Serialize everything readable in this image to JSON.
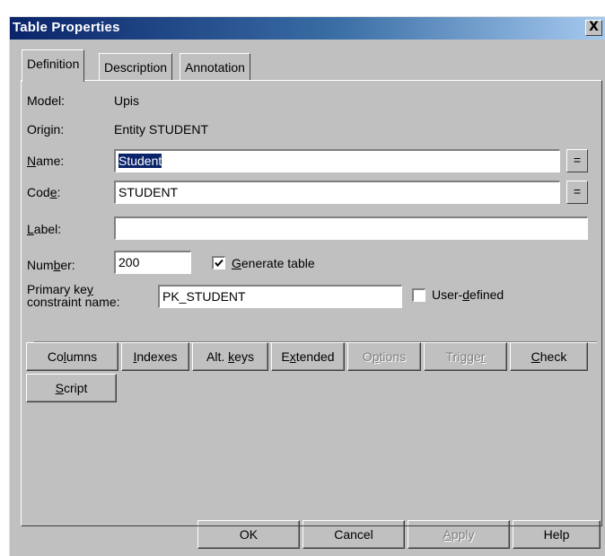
{
  "window": {
    "title": "Table Properties",
    "close_label": "X"
  },
  "tabs": [
    {
      "label": "Definition",
      "active": true
    },
    {
      "label": "Description",
      "active": false
    },
    {
      "label": "Annotation",
      "active": false
    }
  ],
  "fields": {
    "model_label": "Model:",
    "model_value": "Upis",
    "origin_label": "Origin:",
    "origin_value": "Entity STUDENT",
    "name_label": "Name:",
    "name_value": "Student",
    "code_label": "Code:",
    "code_value": "STUDENT",
    "label_label": "Label:",
    "label_value": "",
    "number_label": "Number:",
    "number_value": "200",
    "pk_label_line1": "Primary key",
    "pk_label_line2": "constraint name:",
    "pk_value": "PK_STUDENT"
  },
  "checks": {
    "generate_table": {
      "label": "Generate table",
      "checked": true
    },
    "user_defined": {
      "label": "User-defined",
      "checked": false
    }
  },
  "ellipsis": "=",
  "action_buttons": [
    {
      "label": "Columns",
      "enabled": true
    },
    {
      "label": "Indexes",
      "enabled": true
    },
    {
      "label": "Alt. keys",
      "enabled": true
    },
    {
      "label": "Extended",
      "enabled": true
    },
    {
      "label": "Options",
      "enabled": false
    },
    {
      "label": "Trigger",
      "enabled": false
    },
    {
      "label": "Check",
      "enabled": true
    },
    {
      "label": "Script",
      "enabled": true
    }
  ],
  "footer_buttons": [
    {
      "label": "OK",
      "enabled": true
    },
    {
      "label": "Cancel",
      "enabled": true
    },
    {
      "label": "Apply",
      "enabled": false
    },
    {
      "label": "Help",
      "enabled": true
    }
  ]
}
